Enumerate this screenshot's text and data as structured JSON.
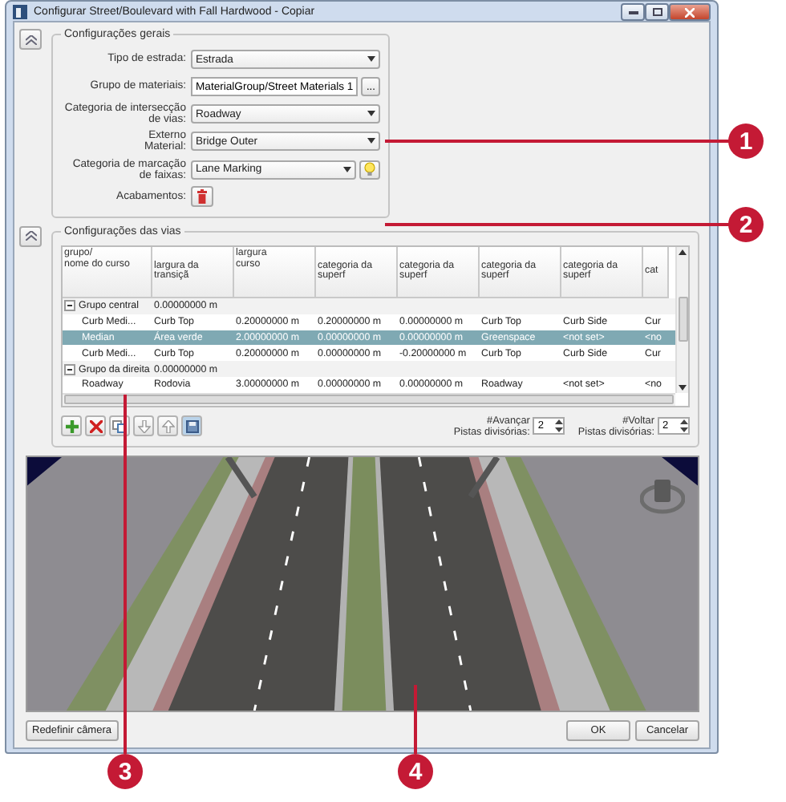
{
  "window": {
    "title": "Configurar Street/Boulevard with Fall Hardwood - Copiar"
  },
  "general": {
    "title": "Configurações gerais",
    "fields": [
      {
        "kind": "select",
        "label": "Tipo de estrada:",
        "value": "Estrada"
      },
      {
        "kind": "browse",
        "label": "Grupo de materiais:",
        "value": "MaterialGroup/Street Materials 1",
        "button": "..."
      },
      {
        "kind": "select",
        "label": "Categoria de intersecção de vias:",
        "value": "Roadway"
      },
      {
        "kind": "select",
        "label": "Externo\nMaterial:",
        "value": "Bridge Outer"
      },
      {
        "kind": "select-bulb",
        "label": "Categoria de marcação de faixas:",
        "value": "Lane Marking"
      },
      {
        "kind": "icon-button",
        "label": "Acabamentos:"
      }
    ]
  },
  "lanes": {
    "title": "Configurações das vias",
    "columns": [
      "grupo/\nnome do curso",
      "largura da transiçã",
      "largura\ncurso",
      "categoria da superf",
      "categoria da superf",
      "categoria da superf",
      "categoria da superf",
      "cat"
    ],
    "rows": [
      {
        "kind": "group",
        "expanded": true,
        "selected": false,
        "cells": [
          "Grupo central",
          "0.00000000 m"
        ]
      },
      {
        "kind": "child",
        "selected": false,
        "cells": [
          "Curb Medi...",
          "Curb Top",
          "0.20000000 m",
          "0.20000000 m",
          "0.00000000 m",
          "Curb Top",
          "Curb Side",
          "Cur"
        ]
      },
      {
        "kind": "child",
        "selected": true,
        "cells": [
          "Median",
          "Área verde",
          "2.00000000 m",
          "0.00000000 m",
          "0.00000000 m",
          "Greenspace",
          "<not set>",
          "<no"
        ]
      },
      {
        "kind": "child",
        "selected": false,
        "cells": [
          "Curb Medi...",
          "Curb Top",
          "0.20000000 m",
          "0.00000000 m",
          "-0.20000000 m",
          "Curb Top",
          "Curb Side",
          "Cur"
        ]
      },
      {
        "kind": "group",
        "expanded": true,
        "selected": false,
        "cells": [
          "Grupo da direita",
          "0.00000000 m"
        ]
      },
      {
        "kind": "child",
        "selected": false,
        "cells": [
          "Roadway",
          "Rodovia",
          "3.00000000 m",
          "0.00000000 m",
          "0.00000000 m",
          "Roadway",
          "<not set>",
          "<no"
        ]
      }
    ],
    "spinners": [
      {
        "label": "#Avançar\nPistas divisórias:",
        "value": "2"
      },
      {
        "label": "#Voltar\nPistas divisórias:",
        "value": "2"
      }
    ]
  },
  "buttons": {
    "reset_camera": "Redefinir câmera",
    "ok": "OK",
    "cancel": "Cancelar"
  },
  "callouts": [
    {
      "number": "1"
    },
    {
      "number": "2"
    },
    {
      "number": "3"
    },
    {
      "number": "4"
    }
  ]
}
